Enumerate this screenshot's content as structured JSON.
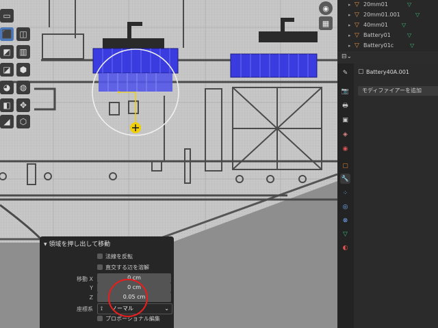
{
  "outliner": {
    "items": [
      {
        "label": "20mm01"
      },
      {
        "label": "20mm01.001"
      },
      {
        "label": "40mm01"
      },
      {
        "label": "Battery01"
      },
      {
        "label": "Battery01c"
      }
    ]
  },
  "properties": {
    "object_name": "Battery40A.001",
    "add_modifier_label": "モディファイアーを追加"
  },
  "operator_panel": {
    "title": "領域を押し出して移動",
    "flip_normals_label": "法線を反転",
    "dissolve_orthogonal_label": "直交する辺を溶解",
    "move_label": "移動 X",
    "y_label": "Y",
    "z_label": "Z",
    "move_x": "0 cm",
    "move_y": "0 cm",
    "move_z": "0.05 cm",
    "orientation_label": "座標系",
    "orientation_value": "ノーマル",
    "proportional_label": "プロポーショナル編集"
  },
  "colors": {
    "selection_blue": "#3a3ce0",
    "accent_red": "#e02020",
    "gizmo_yellow": "#f0d000"
  }
}
